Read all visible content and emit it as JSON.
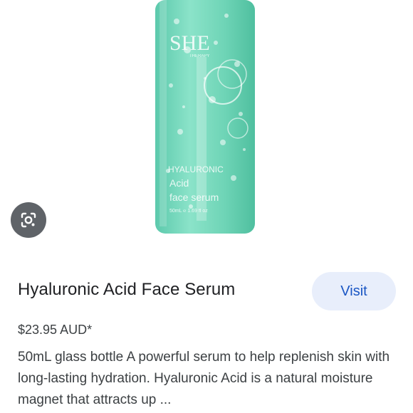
{
  "product": {
    "image": {
      "brand_text": "SHE",
      "brand_sub_text": "THERAPY",
      "label_line1": "HYALURONIC",
      "label_line2": "Acid",
      "label_line3": "face serum",
      "volume_text": "50mL ℮ 1.69 fl oz"
    },
    "title": "Hyaluronic Acid Face Serum",
    "price": "$23.95 AUD*",
    "description": "50mL glass bottle A powerful serum to help replenish skin with long-lasting hydration. Hyaluronic Acid is a natural moisture magnet that attracts up ..."
  },
  "actions": {
    "visit_label": "Visit",
    "lens_icon": "google-lens-icon"
  },
  "colors": {
    "bottle": "#6fd3b8",
    "visit_button_bg": "#e8eefb",
    "visit_button_text": "#1a56c4",
    "lens_button_bg": "#5f6368"
  }
}
